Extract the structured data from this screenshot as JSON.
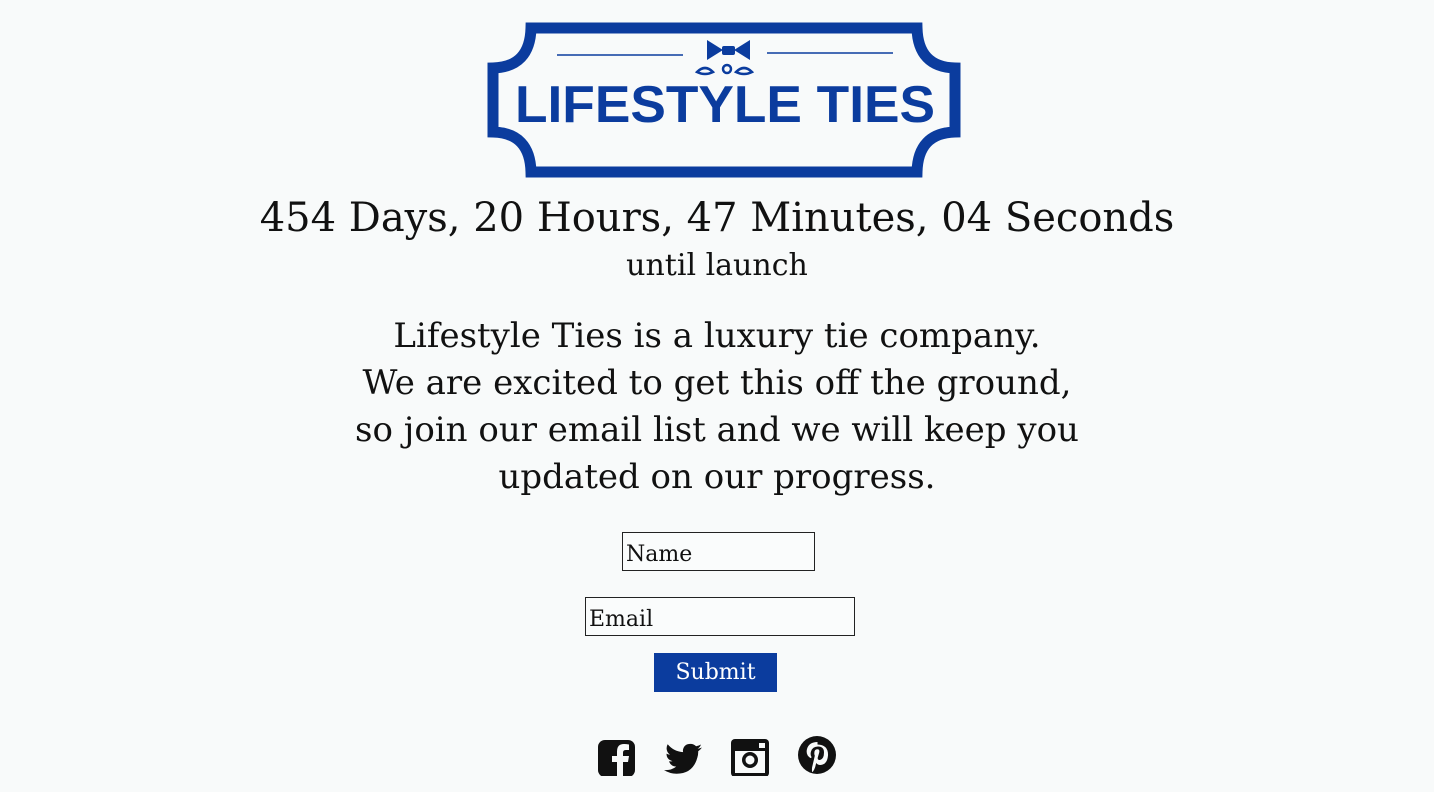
{
  "brand": {
    "name": "LIFESTYLE TIES",
    "color": "#0b3c9e"
  },
  "countdown": {
    "text": "454 Days, 20 Hours, 47 Minutes, 04 Seconds",
    "suffix": "until launch"
  },
  "intro": {
    "lines": [
      "Lifestyle Ties is a luxury tie company.",
      "We are excited to get this off the ground,",
      "so join our email list and we will keep you",
      "updated on our progress."
    ]
  },
  "form": {
    "name_placeholder": "Name",
    "email_placeholder": "Email",
    "submit_label": "Submit"
  },
  "social": [
    {
      "icon": "facebook-icon"
    },
    {
      "icon": "twitter-icon"
    },
    {
      "icon": "instagram-icon"
    },
    {
      "icon": "pinterest-icon"
    }
  ]
}
